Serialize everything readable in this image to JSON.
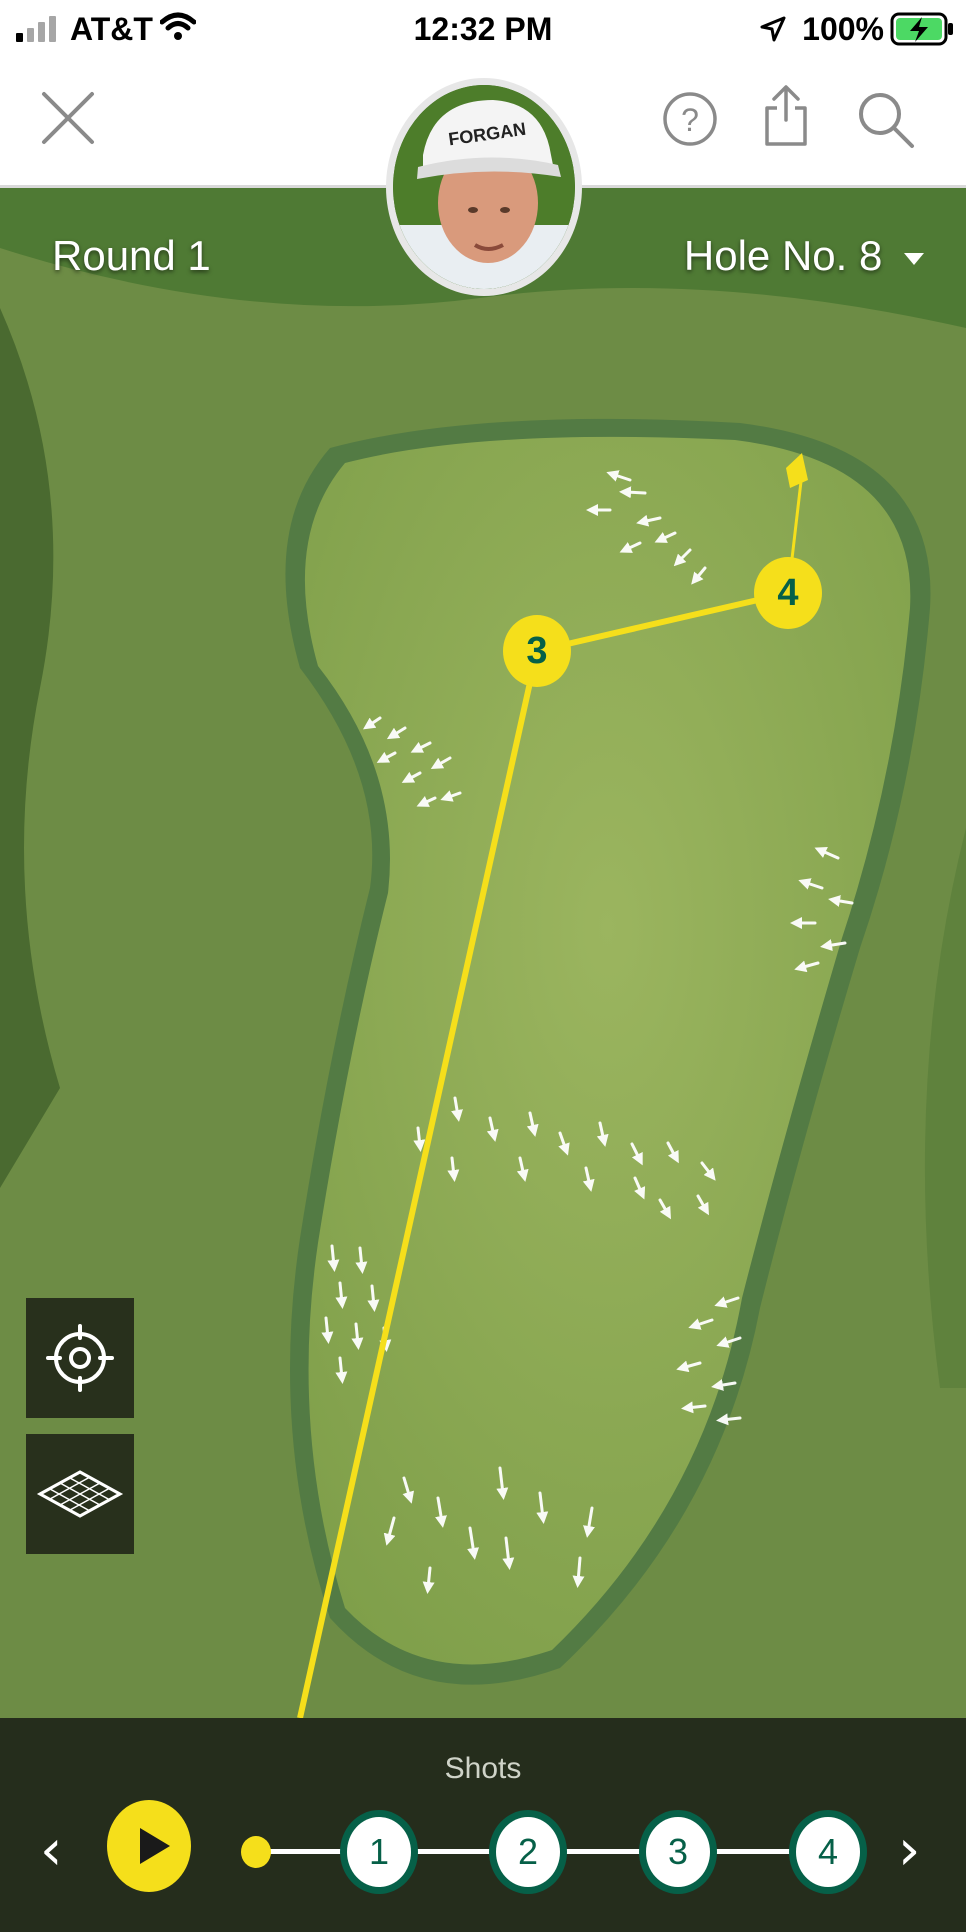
{
  "status_bar": {
    "carrier": "AT&T",
    "time": "12:32 PM",
    "battery": "100%"
  },
  "header": {
    "player_name_on_cap": "FORGAN"
  },
  "course": {
    "round_label": "Round 1",
    "hole_label": "Hole No. 8"
  },
  "markers": [
    {
      "label": "3"
    },
    {
      "label": "4"
    }
  ],
  "shots": {
    "title": "Shots",
    "items": [
      {
        "label": "1"
      },
      {
        "label": "2"
      },
      {
        "label": "3"
      },
      {
        "label": "4"
      }
    ]
  },
  "colors": {
    "accent": "#f5df1b",
    "brand": "#066048",
    "bottom_bar": "#21281a"
  }
}
